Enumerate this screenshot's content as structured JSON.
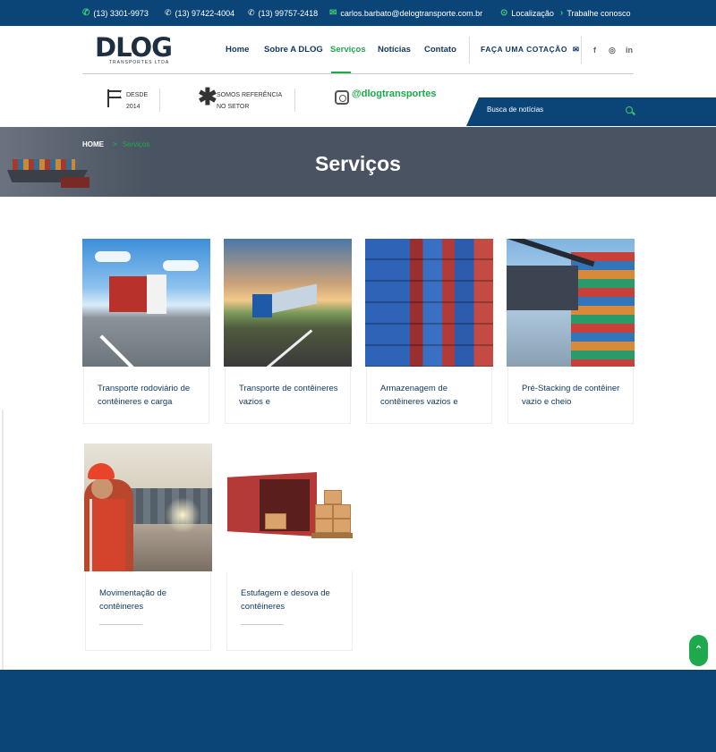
{
  "topbar": {
    "phone": "(13) 3301-9973",
    "whatsapp1": "(13) 97422-4004",
    "whatsapp2": "(13) 99757-2418",
    "email": "carlos.barbato@delogtransporte.com.br",
    "location": "Localização",
    "jobs": "Trabalhe conosco"
  },
  "logo": {
    "main": "DLOG",
    "sub": "TRANSPORTES LTDA"
  },
  "nav": {
    "items": [
      "Home",
      "Sobre A DLOG",
      "Serviços",
      "Notícias",
      "Contato"
    ],
    "active": "Serviços",
    "cta": "FAÇA UMA COTAÇÃO"
  },
  "social": {
    "facebook": "f",
    "instagram": "◎",
    "linkedin": "in"
  },
  "features": {
    "since_label": "DESDE",
    "since_year": "2014",
    "ref_line1": "SOMOS REFERÊNCIA",
    "ref_line2": "NO SETOR",
    "instagram_handle": "@dlogtransportes"
  },
  "search": {
    "placeholder": "Busca de notícias"
  },
  "banner": {
    "breadcrumb_home": "HOME",
    "breadcrumb_sep": ">",
    "breadcrumb_current": "Serviços",
    "title": "Serviços"
  },
  "services": [
    {
      "title": "Transporte rodoviário de contêineres e carga"
    },
    {
      "title": "Transporte de contêineres vazios e"
    },
    {
      "title": "Armazenagem de contêineres vazios e"
    },
    {
      "title": "Pré-Stacking de contêiner vazio e cheio"
    },
    {
      "title": "Movimentação de contêineres"
    },
    {
      "title": "Estufagem e desova de contêineres"
    }
  ],
  "scroll_top": {
    "label": "⌃"
  },
  "colors": {
    "primary": "#0b4477",
    "accent": "#1daa4c",
    "banner": "#4a5361"
  }
}
